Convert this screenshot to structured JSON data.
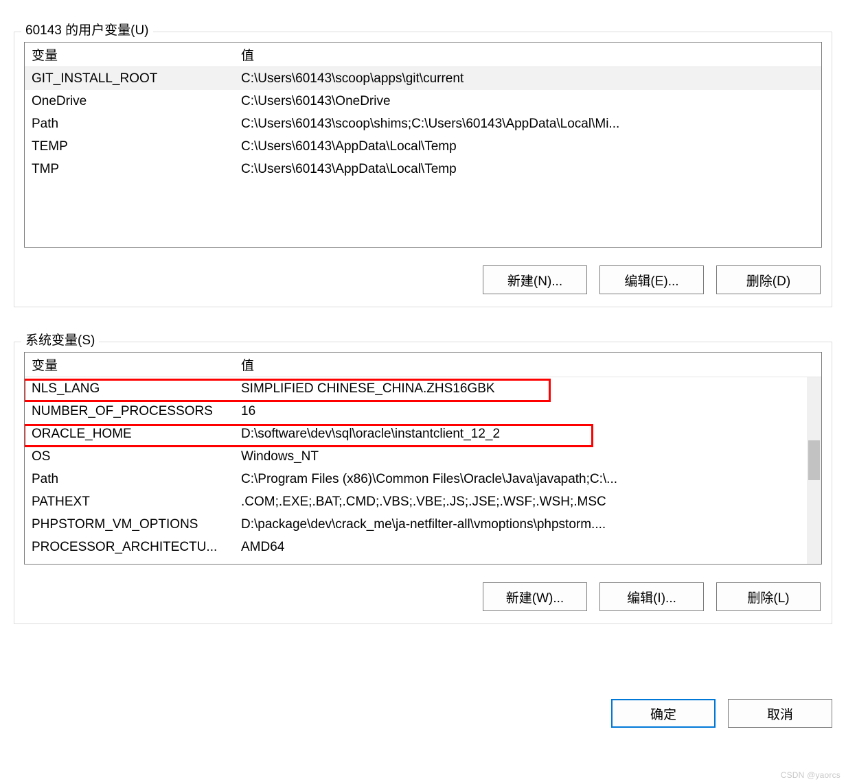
{
  "user_section": {
    "legend": "60143 的用户变量(U)",
    "headers": {
      "name": "变量",
      "value": "值"
    },
    "rows": [
      {
        "name": "GIT_INSTALL_ROOT",
        "value": "C:\\Users\\60143\\scoop\\apps\\git\\current",
        "selected": true
      },
      {
        "name": "OneDrive",
        "value": "C:\\Users\\60143\\OneDrive",
        "selected": false
      },
      {
        "name": "Path",
        "value": "C:\\Users\\60143\\scoop\\shims;C:\\Users\\60143\\AppData\\Local\\Mi...",
        "selected": false
      },
      {
        "name": "TEMP",
        "value": "C:\\Users\\60143\\AppData\\Local\\Temp",
        "selected": false
      },
      {
        "name": "TMP",
        "value": "C:\\Users\\60143\\AppData\\Local\\Temp",
        "selected": false
      }
    ],
    "buttons": {
      "new": "新建(N)...",
      "edit": "编辑(E)...",
      "delete": "删除(D)"
    }
  },
  "system_section": {
    "legend": "系统变量(S)",
    "headers": {
      "name": "变量",
      "value": "值"
    },
    "rows": [
      {
        "name": "NLS_LANG",
        "value": "SIMPLIFIED CHINESE_CHINA.ZHS16GBK"
      },
      {
        "name": "NUMBER_OF_PROCESSORS",
        "value": "16"
      },
      {
        "name": "ORACLE_HOME",
        "value": "D:\\software\\dev\\sql\\oracle\\instantclient_12_2"
      },
      {
        "name": "OS",
        "value": "Windows_NT"
      },
      {
        "name": "Path",
        "value": "C:\\Program Files (x86)\\Common Files\\Oracle\\Java\\javapath;C:\\..."
      },
      {
        "name": "PATHEXT",
        "value": ".COM;.EXE;.BAT;.CMD;.VBS;.VBE;.JS;.JSE;.WSF;.WSH;.MSC"
      },
      {
        "name": "PHPSTORM_VM_OPTIONS",
        "value": "D:\\package\\dev\\crack_me\\ja-netfilter-all\\vmoptions\\phpstorm...."
      },
      {
        "name": "PROCESSOR_ARCHITECTU...",
        "value": "AMD64"
      }
    ],
    "buttons": {
      "new": "新建(W)...",
      "edit": "编辑(I)...",
      "delete": "删除(L)"
    }
  },
  "dialog_buttons": {
    "ok": "确定",
    "cancel": "取消"
  },
  "watermark": "CSDN @yaorcs"
}
